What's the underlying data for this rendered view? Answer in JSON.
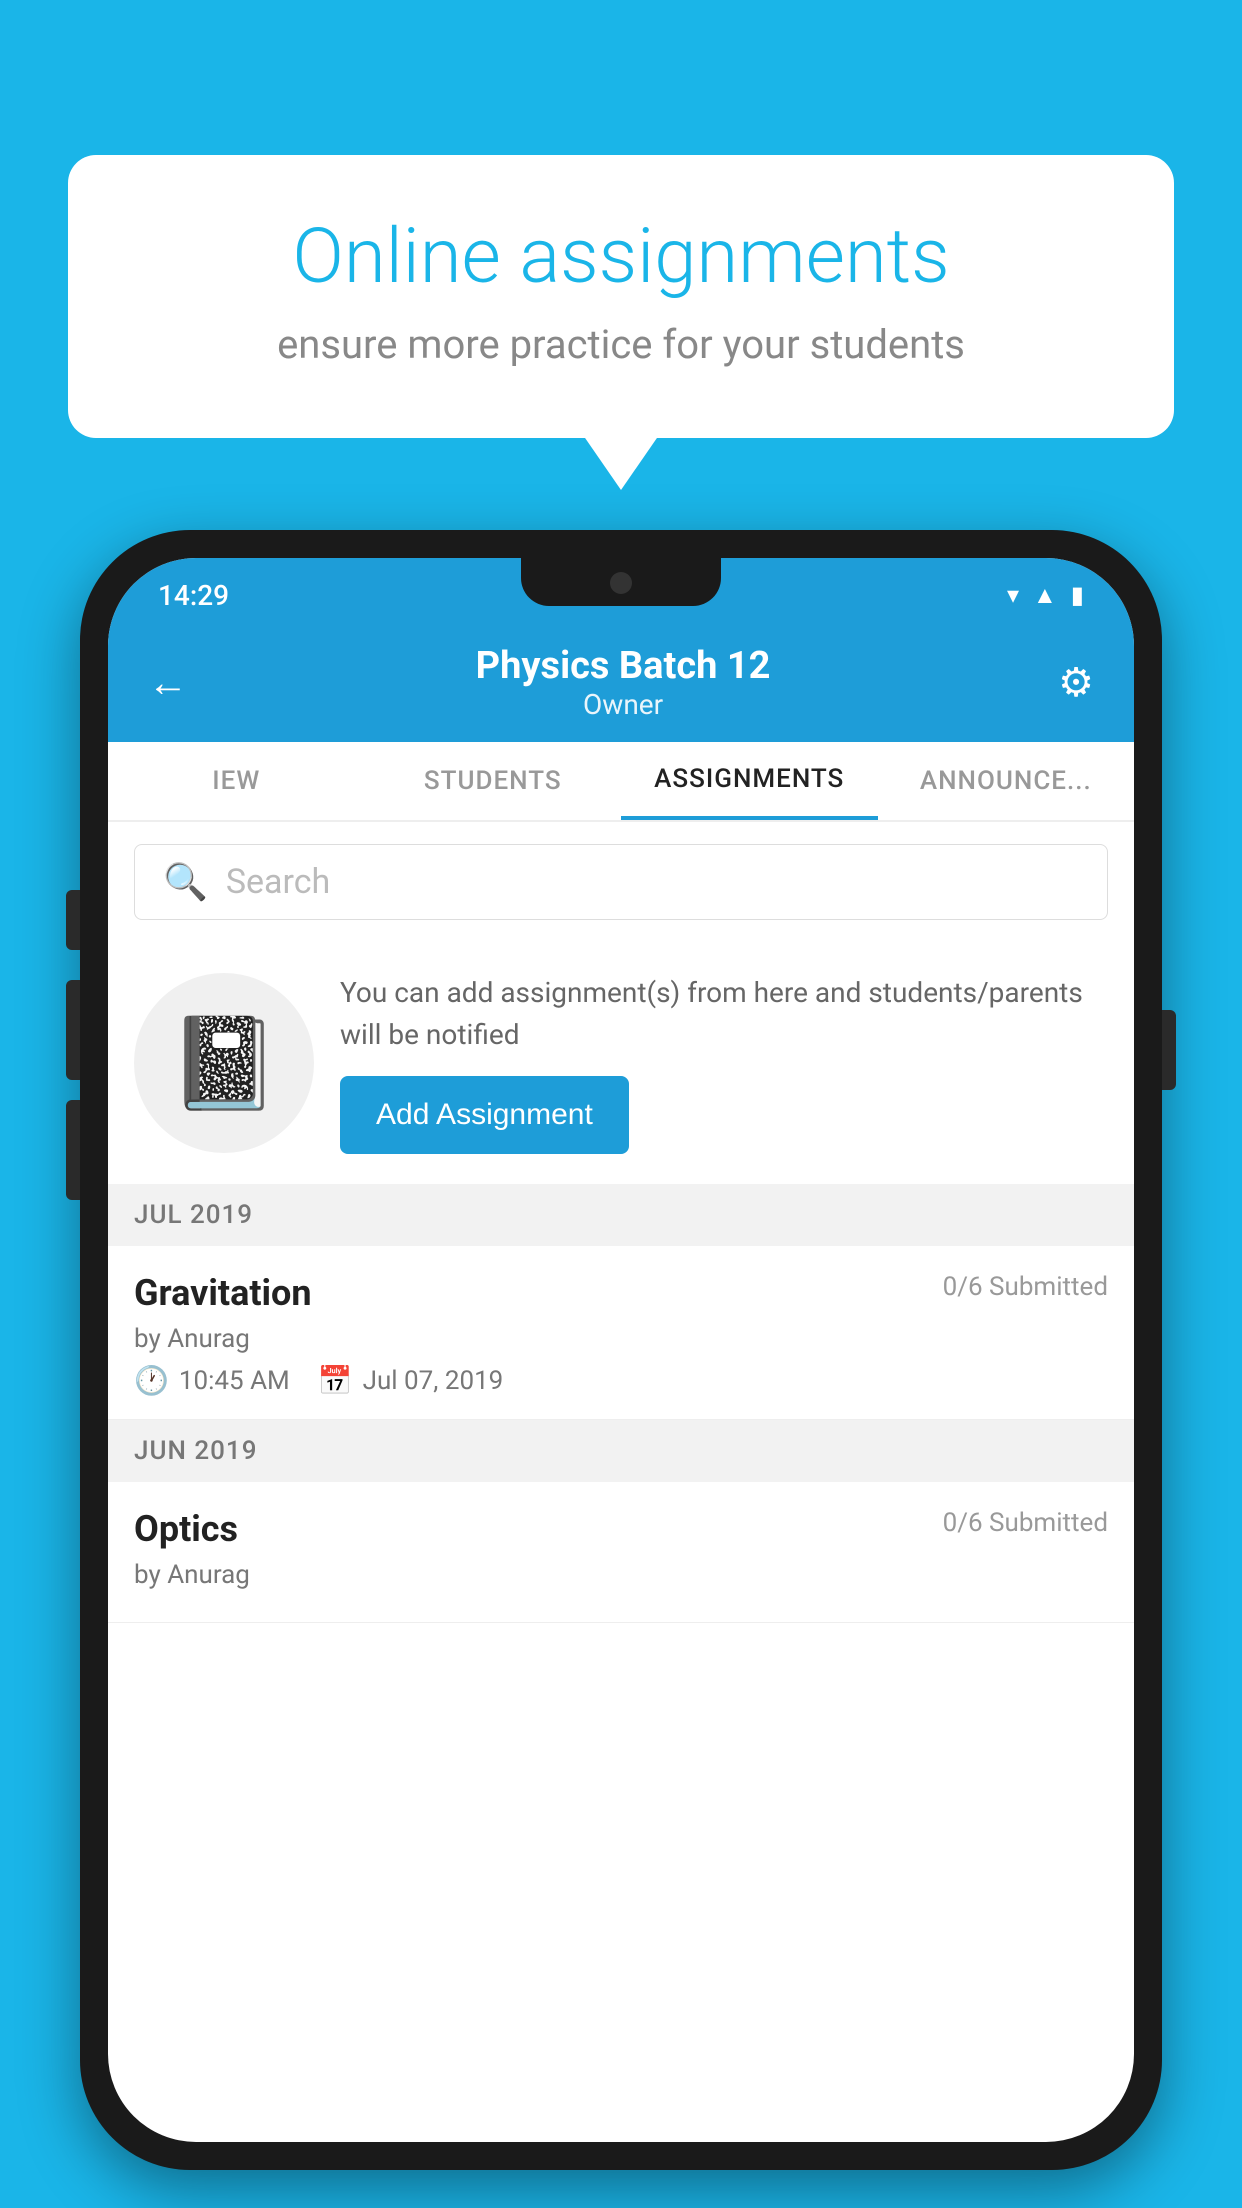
{
  "background_color": "#1ab5e8",
  "speech_bubble": {
    "title": "Online assignments",
    "subtitle": "ensure more practice for your students"
  },
  "status_bar": {
    "time": "14:29",
    "icons": [
      "wifi",
      "signal",
      "battery"
    ]
  },
  "header": {
    "title": "Physics Batch 12",
    "subtitle": "Owner",
    "back_label": "←",
    "settings_label": "⚙"
  },
  "tabs": [
    {
      "label": "IEW",
      "active": false
    },
    {
      "label": "STUDENTS",
      "active": false
    },
    {
      "label": "ASSIGNMENTS",
      "active": true
    },
    {
      "label": "ANNOUNCEMENTS",
      "active": false
    }
  ],
  "search": {
    "placeholder": "Search"
  },
  "promo": {
    "text": "You can add assignment(s) from here and students/parents will be notified",
    "add_button_label": "Add Assignment"
  },
  "sections": [
    {
      "month_label": "JUL 2019",
      "assignments": [
        {
          "title": "Gravitation",
          "submitted": "0/6 Submitted",
          "by": "by Anurag",
          "time": "10:45 AM",
          "date": "Jul 07, 2019"
        }
      ]
    },
    {
      "month_label": "JUN 2019",
      "assignments": [
        {
          "title": "Optics",
          "submitted": "0/6 Submitted",
          "by": "by Anurag",
          "time": "",
          "date": ""
        }
      ]
    }
  ]
}
